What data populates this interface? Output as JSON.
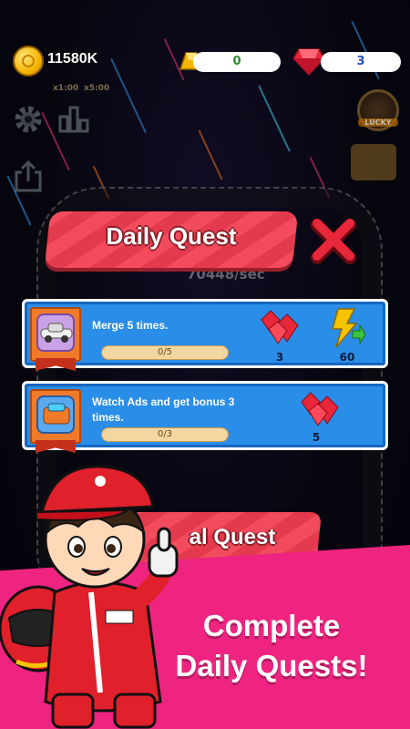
{
  "hud": {
    "coins": "11580K",
    "gold": "0",
    "rubies": "3",
    "boost_left": "x1:00",
    "boost_right": "x5:00",
    "lucky_label": "LUCKY",
    "income_rate": "70448/sec"
  },
  "dialog": {
    "title": "Daily Quest",
    "quests": [
      {
        "text": "Merge 5 times.",
        "progress_label": "0/5",
        "progress": 0,
        "reward_rubies": "3",
        "reward_boost": "60"
      },
      {
        "text": "Watch Ads and get bonus 3 times.",
        "progress_label": "0/3",
        "progress": 0,
        "reward_rubies": "5"
      }
    ],
    "second_title_partial": "al Quest"
  },
  "promo": {
    "line1": "Complete",
    "line2": "Daily Quests!"
  },
  "colors": {
    "banner": "#f14b5d",
    "card": "#2a8ee8",
    "promo": "#ee2480",
    "coin": "#f5b400"
  }
}
